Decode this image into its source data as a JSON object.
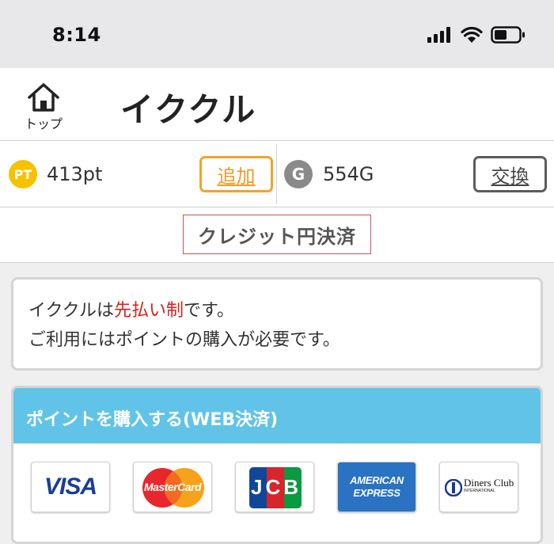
{
  "status_bar": {
    "time": "8:14"
  },
  "header": {
    "home_label": "トップ",
    "title": "イククル"
  },
  "balance": {
    "pt_badge": "PT",
    "pt_value": "413pt",
    "add_label": "追加",
    "g_badge": "G",
    "g_value": "554G",
    "exchange_label": "交換"
  },
  "payment": {
    "label": "クレジット円決済"
  },
  "notice": {
    "line1_prefix": "イククルは",
    "line1_highlight": "先払い制",
    "line1_suffix": "です。",
    "line2": "ご利用にはポイントの購入が必要です。"
  },
  "purchase": {
    "heading": "ポイントを購入する(WEB決済)",
    "cards": [
      {
        "name": "VISA"
      },
      {
        "name": "MasterCard"
      },
      {
        "name": "JCB"
      },
      {
        "name": "AMERICAN",
        "sub": "EXPRESS"
      },
      {
        "name": "Diners Club",
        "sub": "INTERNATIONAL"
      }
    ]
  },
  "colors": {
    "accent_orange": "#f0a42a",
    "highlight_red": "#d4221b",
    "section_blue": "#62c3e8",
    "coin_yellow": "#f6c200",
    "coin_gray": "#8a8a8a"
  }
}
